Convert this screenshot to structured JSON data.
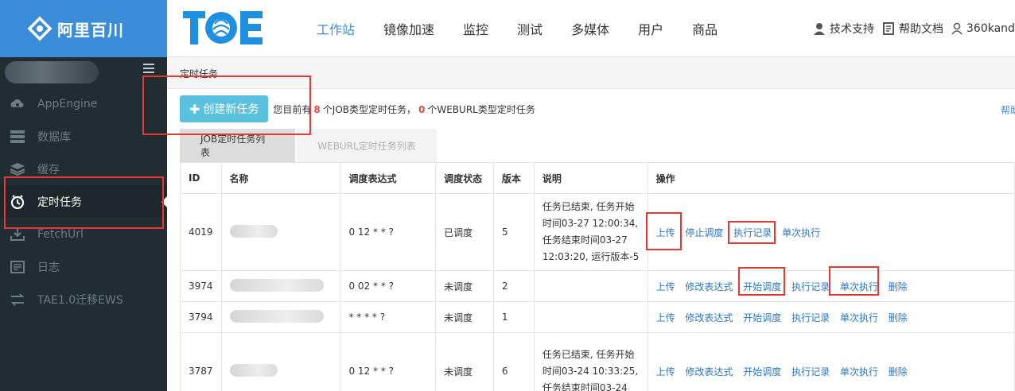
{
  "brand": {
    "name": "阿里百川"
  },
  "sidebar": {
    "items": [
      {
        "label": "AppEngine",
        "icon": "cloud-icon",
        "active": false
      },
      {
        "label": "数据库",
        "icon": "database-icon",
        "active": false
      },
      {
        "label": "缓存",
        "icon": "layers-icon",
        "active": false
      },
      {
        "label": "定时任务",
        "icon": "clock-icon",
        "active": true
      },
      {
        "label": "FetchUrl",
        "icon": "download-icon",
        "active": false
      },
      {
        "label": "日志",
        "icon": "log-icon",
        "active": false
      },
      {
        "label": "TAE1.0迁移EWS",
        "icon": "swap-icon",
        "active": false
      }
    ]
  },
  "topnav": {
    "logo": "TAE",
    "items": [
      "工作站",
      "镜像加速",
      "监控",
      "测试",
      "多媒体",
      "用户",
      "商品"
    ],
    "active_index": 0
  },
  "topright": {
    "support": "技术支持",
    "docs": "帮助文档",
    "user": "360kand"
  },
  "breadcrumb": "定时任务",
  "actions": {
    "create_label": "创建新任务",
    "summary_prefix": "您目前有",
    "job_count": "8",
    "summary_mid": "个JOB类型定时任务，",
    "weburl_count": "0",
    "summary_suffix": "个WEBURL类型定时任务",
    "help": "帮助"
  },
  "tabs": [
    {
      "label": "JOB定时任务列表",
      "active": true
    },
    {
      "label": "WEBURL定时任务列表",
      "active": false
    }
  ],
  "table": {
    "headers": [
      "ID",
      "名称",
      "调度表达式",
      "调度状态",
      "版本",
      "说明",
      "操作"
    ],
    "rows": [
      {
        "id": "4019",
        "cron": "0 12 * * ?",
        "status": "已调度",
        "version": "5",
        "desc": "任务已结束, 任务开始时间03-27 12:00:34, 任务结束时间03-27 12:03:20, 运行版本-5",
        "ops": [
          "上传",
          "停止调度",
          "执行记录",
          "单次执行"
        ]
      },
      {
        "id": "3974",
        "cron": "0 02 * * ?",
        "status": "未调度",
        "version": "2",
        "desc": "",
        "ops": [
          "上传",
          "修改表达式",
          "开始调度",
          "执行记录",
          "单次执行",
          "删除"
        ]
      },
      {
        "id": "3794",
        "cron": "* * * * ?",
        "status": "未调度",
        "version": "1",
        "desc": "",
        "ops": [
          "上传",
          "修改表达式",
          "开始调度",
          "执行记录",
          "单次执行",
          "删除"
        ]
      },
      {
        "id": "3787",
        "cron": "0 12 * * ?",
        "status": "未调度",
        "version": "6",
        "desc": "任务已结束, 任务开始时间03-24 10:33:25, 任务结束时间03-24",
        "ops": [
          "上传",
          "修改表达式",
          "开始调度",
          "执行记录",
          "单次执行",
          "删除"
        ]
      }
    ]
  },
  "colors": {
    "brand_blue": "#3c8dd9",
    "sidebar_bg": "#222d32",
    "create_btn": "#5bc0de",
    "link": "#2a78c2",
    "annotation_red": "#e53935",
    "count_red": "#e74c3c"
  }
}
